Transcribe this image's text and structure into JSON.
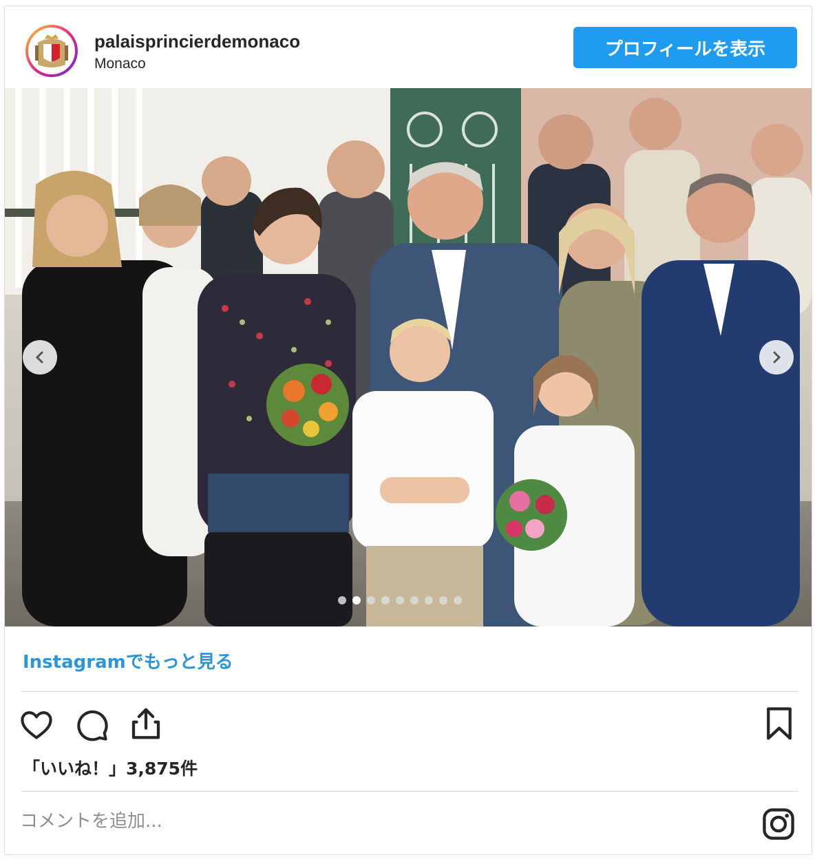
{
  "post": {
    "username": "palaisprincierdemonaco",
    "location": "Monaco",
    "profile_button_label": "プロフィールを表示",
    "more_on_instagram_label": "Instagramでもっと見る",
    "likes_text": "「いいね！」3,875件",
    "comment_placeholder": "コメントを追加...",
    "carousel": {
      "slide_count": 9,
      "active_index": 1
    }
  },
  "icons": [
    "heart-icon",
    "comment-icon",
    "share-icon",
    "bookmark-icon",
    "instagram-logo-icon",
    "chevron-left-icon",
    "chevron-right-icon"
  ],
  "colors": {
    "accent": "#1f9bf0",
    "link": "#2d95d6",
    "text": "#262626",
    "muted": "#8e8e8e",
    "border": "#dbdbdb"
  }
}
